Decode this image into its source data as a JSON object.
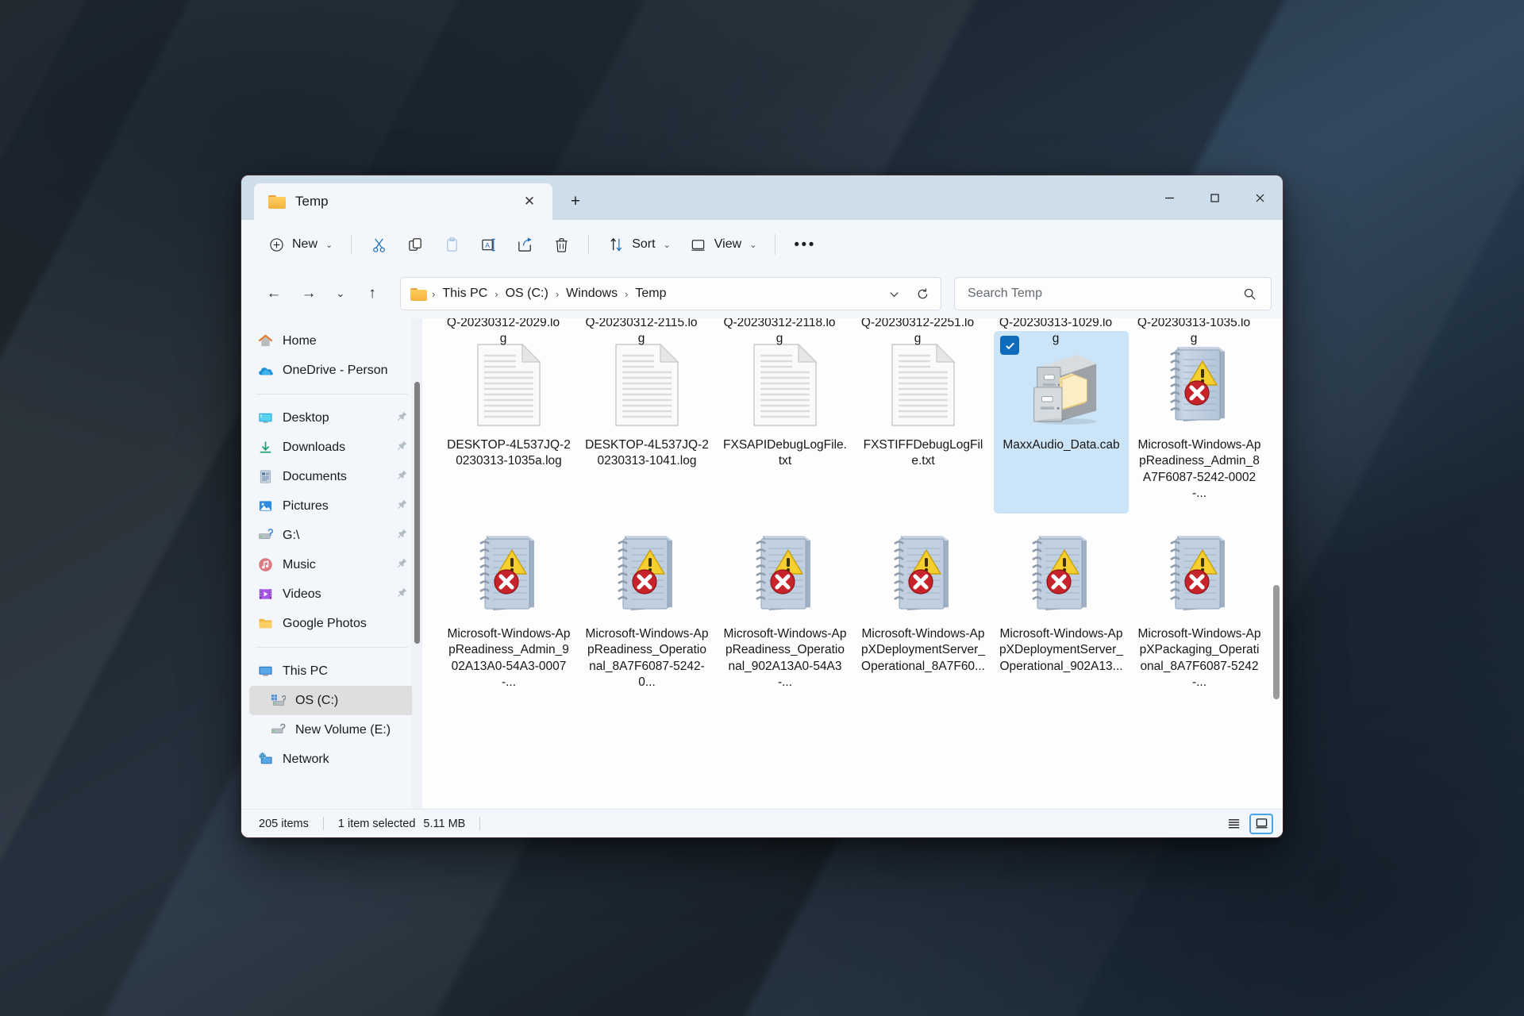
{
  "window": {
    "tab": {
      "title": "Temp",
      "icon": "folder-icon",
      "close_label": "✕"
    },
    "new_tab_label": "+",
    "controls": {
      "minimize": "minimize-icon",
      "maximize": "maximize-icon",
      "close": "close-icon"
    }
  },
  "toolbar": {
    "new_label": "New",
    "cut_label": "cut-icon",
    "copy_label": "copy-icon",
    "paste_label": "paste-icon",
    "rename_label": "rename-icon",
    "share_label": "share-icon",
    "delete_label": "delete-icon",
    "sort_label": "Sort",
    "view_label": "View",
    "more_label": "•••"
  },
  "address": {
    "back": "←",
    "forward": "→",
    "recent": "⌄",
    "up": "↑",
    "breadcrumbs": [
      "This PC",
      "OS (C:)",
      "Windows",
      "Temp"
    ],
    "dropdown_label": "chevron-down-icon",
    "refresh_label": "refresh-icon"
  },
  "search": {
    "placeholder": "Search Temp",
    "value": "",
    "icon": "search-icon"
  },
  "sidebar": {
    "groups": [
      {
        "items": [
          {
            "label": "Home",
            "icon": "home-icon",
            "pinned": false,
            "selected": false,
            "indent": false
          },
          {
            "label": "OneDrive - Person",
            "icon": "onedrive-icon",
            "pinned": false,
            "selected": false,
            "indent": false
          }
        ]
      },
      {
        "items": [
          {
            "label": "Desktop",
            "icon": "desktop-icon",
            "pinned": true,
            "selected": false,
            "indent": false
          },
          {
            "label": "Downloads",
            "icon": "downloads-icon",
            "pinned": true,
            "selected": false,
            "indent": false
          },
          {
            "label": "Documents",
            "icon": "documents-icon",
            "pinned": true,
            "selected": false,
            "indent": false
          },
          {
            "label": "Pictures",
            "icon": "pictures-icon",
            "pinned": true,
            "selected": false,
            "indent": false
          },
          {
            "label": "G:\\",
            "icon": "drive-icon",
            "pinned": true,
            "selected": false,
            "indent": false
          },
          {
            "label": "Music",
            "icon": "music-icon",
            "pinned": true,
            "selected": false,
            "indent": false
          },
          {
            "label": "Videos",
            "icon": "videos-icon",
            "pinned": true,
            "selected": false,
            "indent": false
          },
          {
            "label": "Google Photos",
            "icon": "folder-icon",
            "pinned": false,
            "selected": false,
            "indent": false
          }
        ]
      },
      {
        "items": [
          {
            "label": "This PC",
            "icon": "pc-icon",
            "pinned": false,
            "selected": false,
            "indent": false
          },
          {
            "label": "OS (C:)",
            "icon": "os-drive-icon",
            "pinned": false,
            "selected": true,
            "indent": true
          },
          {
            "label": "New Volume (E:)",
            "icon": "drive-icon",
            "pinned": false,
            "selected": false,
            "indent": true
          },
          {
            "label": "Network",
            "icon": "network-icon",
            "pinned": false,
            "selected": false,
            "indent": false
          }
        ]
      }
    ]
  },
  "files": [
    {
      "name": "Q-20230312-2029.log",
      "icon": "text-document-icon",
      "selected": false,
      "label_top": true
    },
    {
      "name": "Q-20230312-2115.log",
      "icon": "text-document-icon",
      "selected": false,
      "label_top": true
    },
    {
      "name": "Q-20230312-2118.log",
      "icon": "text-document-icon",
      "selected": false,
      "label_top": true
    },
    {
      "name": "Q-20230312-2251.log",
      "icon": "text-document-icon",
      "selected": false,
      "label_top": true
    },
    {
      "name": "Q-20230313-1029.log",
      "icon": "text-document-icon",
      "selected": false,
      "label_top": true
    },
    {
      "name": "Q-20230313-1035.log",
      "icon": "text-document-icon",
      "selected": false,
      "label_top": true
    },
    {
      "name": "DESKTOP-4L537JQ-20230313-1035a.log",
      "icon": "text-document-icon",
      "selected": false,
      "label_top": false
    },
    {
      "name": "DESKTOP-4L537JQ-20230313-1041.log",
      "icon": "text-document-icon",
      "selected": false,
      "label_top": false
    },
    {
      "name": "FXSAPIDebugLogFile.txt",
      "icon": "text-document-icon",
      "selected": false,
      "label_top": false
    },
    {
      "name": "FXSTIFFDebugLogFile.txt",
      "icon": "text-document-icon",
      "selected": false,
      "label_top": false
    },
    {
      "name": "MaxxAudio_Data.cab",
      "icon": "cabinet-icon",
      "selected": true,
      "label_top": false
    },
    {
      "name": "Microsoft-Windows-AppReadiness_Admin_8A7F6087-5242-0002-...",
      "icon": "etl-error-icon",
      "selected": false,
      "label_top": false
    },
    {
      "name": "Microsoft-Windows-AppReadiness_Admin_902A13A0-54A3-0007-...",
      "icon": "etl-error-icon",
      "selected": false,
      "label_top": false
    },
    {
      "name": "Microsoft-Windows-AppReadiness_Operational_8A7F6087-5242-0...",
      "icon": "etl-error-icon",
      "selected": false,
      "label_top": false
    },
    {
      "name": "Microsoft-Windows-AppReadiness_Operational_902A13A0-54A3-...",
      "icon": "etl-error-icon",
      "selected": false,
      "label_top": false
    },
    {
      "name": "Microsoft-Windows-AppXDeploymentServer_Operational_8A7F60...",
      "icon": "etl-error-icon",
      "selected": false,
      "label_top": false
    },
    {
      "name": "Microsoft-Windows-AppXDeploymentServer_Operational_902A13...",
      "icon": "etl-error-icon",
      "selected": false,
      "label_top": false
    },
    {
      "name": "Microsoft-Windows-AppXPackaging_Operational_8A7F6087-5242-...",
      "icon": "etl-error-icon",
      "selected": false,
      "label_top": false
    }
  ],
  "statusbar": {
    "item_count": "205 items",
    "selection": "1 item selected",
    "selection_size": "5.11 MB",
    "view_list": "list-view-icon",
    "view_large_icons": "large-icons-view-icon"
  },
  "colors": {
    "accent": "#0f6cbd",
    "selection_bg": "#cce4f7",
    "titlebar_bg": "#cddeea",
    "chrome_bg": "#f3f6fb",
    "content_bg": "#fdfdfe",
    "view_active_border": "#4aa3e8"
  }
}
